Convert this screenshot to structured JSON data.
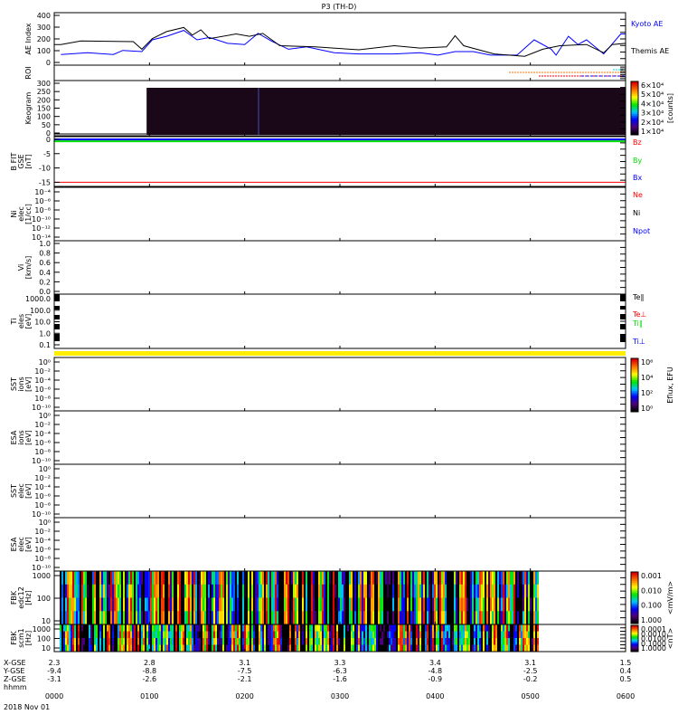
{
  "title": "P3 (TH-D)",
  "chart_data": [
    {
      "type": "line",
      "id": "ae",
      "ylabel": "AE Index",
      "ylim": [
        0,
        400
      ],
      "yticks": [
        "0",
        "100",
        "200",
        "300",
        "400"
      ],
      "xlim_hours": [
        0,
        6
      ],
      "series": [
        {
          "name": "Kyoto AE",
          "color": "#0000ff",
          "x": [
            0.07,
            0.35,
            0.62,
            0.72,
            0.92,
            1.03,
            1.18,
            1.36,
            1.5,
            1.63,
            1.82,
            2.0,
            2.14,
            2.28,
            2.46,
            2.65,
            2.94,
            3.2,
            3.57,
            3.84,
            4.03,
            4.21,
            4.4,
            4.58,
            4.86,
            5.04,
            5.22,
            5.27,
            5.4,
            5.5,
            5.59,
            5.77,
            5.95,
            6.0
          ],
          "y": [
            75,
            90,
            75,
            110,
            100,
            200,
            230,
            280,
            200,
            220,
            170,
            160,
            255,
            190,
            120,
            140,
            90,
            80,
            80,
            90,
            70,
            100,
            100,
            70,
            70,
            200,
            120,
            70,
            230,
            160,
            200,
            80,
            250,
            250
          ]
        },
        {
          "name": "Themis AE",
          "color": "#000000",
          "x": [
            0.0,
            0.07,
            0.28,
            0.83,
            0.92,
            1.03,
            1.18,
            1.36,
            1.45,
            1.54,
            1.63,
            1.91,
            2.05,
            2.19,
            2.37,
            2.74,
            3.2,
            3.57,
            3.84,
            4.12,
            4.21,
            4.3,
            4.62,
            4.94,
            5.13,
            5.31,
            5.59,
            5.77,
            5.86,
            6.0
          ],
          "y": [
            160,
            160,
            190,
            185,
            120,
            210,
            270,
            305,
            240,
            285,
            210,
            250,
            230,
            255,
            150,
            140,
            115,
            150,
            130,
            140,
            235,
            150,
            80,
            60,
            120,
            150,
            160,
            90,
            160,
            170
          ]
        }
      ]
    },
    {
      "type": "heatmap",
      "id": "roi",
      "ylabel": "ROI"
    },
    {
      "type": "heatmap",
      "id": "keogram",
      "ylabel": "Keogram",
      "ylim": [
        0,
        300
      ],
      "yticks": [
        "0",
        "50",
        "100",
        "150",
        "200",
        "250",
        "300"
      ],
      "colorbar": {
        "label": "[counts]",
        "ticks": [
          "1×10⁴",
          "2×10⁴",
          "3×10⁴",
          "4×10⁴",
          "5×10⁴",
          "6×10⁴"
        ]
      },
      "data_start_hour": 0.97
    },
    {
      "type": "line",
      "id": "bfit",
      "ylabel": "B FIT",
      "ylabel2": "GSE",
      "units": "[nT]",
      "ylim": [
        -15.5,
        0.3
      ],
      "yticks": [
        "-15",
        "-10",
        "-5",
        "0"
      ],
      "series": [
        {
          "name": "Bz",
          "color": "#ff0000",
          "value": -15
        },
        {
          "name": "By",
          "color": "#00dd00",
          "value": -0.7
        },
        {
          "name": "Bx",
          "color": "#0000ff",
          "value": 0
        }
      ]
    },
    {
      "type": "line",
      "id": "ni",
      "ylabel": "Ni",
      "ylabel2": "elec",
      "units": "[1/cc]",
      "yticks": [
        "10⁻⁴",
        "10⁻⁶",
        "10⁻⁸",
        "10⁻¹⁰",
        "10⁻¹²",
        "10⁻¹⁴"
      ],
      "series": [
        {
          "name": "Ne",
          "color": "#ff0000"
        },
        {
          "name": "Ni",
          "color": "#000000"
        },
        {
          "name": "Npot",
          "color": "#0000ff"
        }
      ]
    },
    {
      "type": "line",
      "id": "vi",
      "ylabel": "Vi",
      "units": "[km/s]",
      "ylim": [
        0,
        1
      ],
      "yticks": [
        "1.0",
        "0.8",
        "0.6",
        "0.4",
        "0.2",
        "0.0"
      ]
    },
    {
      "type": "line",
      "id": "ti",
      "ylabel": "Ti",
      "ylabel2": "eles",
      "units": "[eV]",
      "yticks": [
        "1000.0",
        "100.0",
        "10.0",
        "1.0",
        "0.1"
      ],
      "series": [
        {
          "name": "Te∥",
          "color": "#000000"
        },
        {
          "name": "Te⊥",
          "color": "#ff0000"
        },
        {
          "name": "Ti∥",
          "color": "#00dd00"
        },
        {
          "name": "Ti⊥",
          "color": "#0000ff"
        }
      ]
    },
    {
      "type": "heatmap",
      "id": "sst_ion",
      "ylabel": "SST",
      "ylabel2": "ions",
      "units": "[eV]",
      "yticks": [
        "10⁰",
        "10⁻²",
        "10⁻⁴",
        "10⁻⁶",
        "10⁻⁸",
        "10⁻¹⁰"
      ],
      "colorbar": {
        "label": "Eflux, EFU",
        "ticks": [
          "10⁰",
          "10²",
          "10⁴",
          "10⁶"
        ]
      }
    },
    {
      "type": "heatmap",
      "id": "esa_ion",
      "ylabel": "ESA",
      "ylabel2": "ions",
      "units": "[eV]",
      "yticks": [
        "10⁰",
        "10⁻²",
        "10⁻⁴",
        "10⁻⁶",
        "10⁻⁸",
        "10⁻¹⁰"
      ]
    },
    {
      "type": "heatmap",
      "id": "sst_elec",
      "ylabel": "SST",
      "ylabel2": "elec",
      "units": "[eV]",
      "yticks": [
        "10⁰",
        "10⁻²",
        "10⁻⁴",
        "10⁻⁶",
        "10⁻⁸",
        "10⁻¹⁰"
      ]
    },
    {
      "type": "heatmap",
      "id": "esa_elec",
      "ylabel": "ESA",
      "ylabel2": "elec",
      "units": "[eV]",
      "yticks": [
        "10⁰",
        "10⁻²",
        "10⁻⁴",
        "10⁻⁶",
        "10⁻⁸",
        "10⁻¹⁰"
      ]
    },
    {
      "type": "heatmap",
      "id": "fbk_edc",
      "ylabel": "FBK",
      "ylabel2": "edc12",
      "units": "[Hz]",
      "yticks": [
        "1000",
        "100",
        "10"
      ],
      "data_end_hour": 5.08,
      "colorbar": {
        "label": "<mV/m>",
        "ticks": [
          "1.000",
          "0.100",
          "0.010",
          "0.001"
        ]
      }
    },
    {
      "type": "heatmap",
      "id": "fbk_scm",
      "ylabel": "FBK",
      "ylabel2": "scm1",
      "units": "[Hz]",
      "yticks": [
        "1000",
        "100",
        "10"
      ],
      "data_end_hour": 5.08,
      "colorbar": {
        "label": "<nT>",
        "ticks": [
          "1.0000",
          "0.1000",
          "0.0100",
          "0.0010",
          "0.0001"
        ]
      }
    }
  ],
  "ephemeris": {
    "row_labels": [
      "X-GSE",
      "Y-GSE",
      "Z-GSE",
      "hhmm"
    ],
    "date": "2018 Nov 01",
    "columns": [
      [
        "2.3",
        "-9.4",
        "-3.1",
        "0000"
      ],
      [
        "2.8",
        "-8.8",
        "-2.6",
        "0100"
      ],
      [
        "3.1",
        "-7.5",
        "-2.1",
        "0200"
      ],
      [
        "3.3",
        "-6.3",
        "-1.6",
        "0300"
      ],
      [
        "3.4",
        "-4.8",
        "-0.9",
        "0400"
      ],
      [
        "3.1",
        "-2.5",
        "-0.2",
        "0500"
      ],
      [
        "1.5",
        "0.4",
        "0.5",
        "0600"
      ]
    ]
  }
}
